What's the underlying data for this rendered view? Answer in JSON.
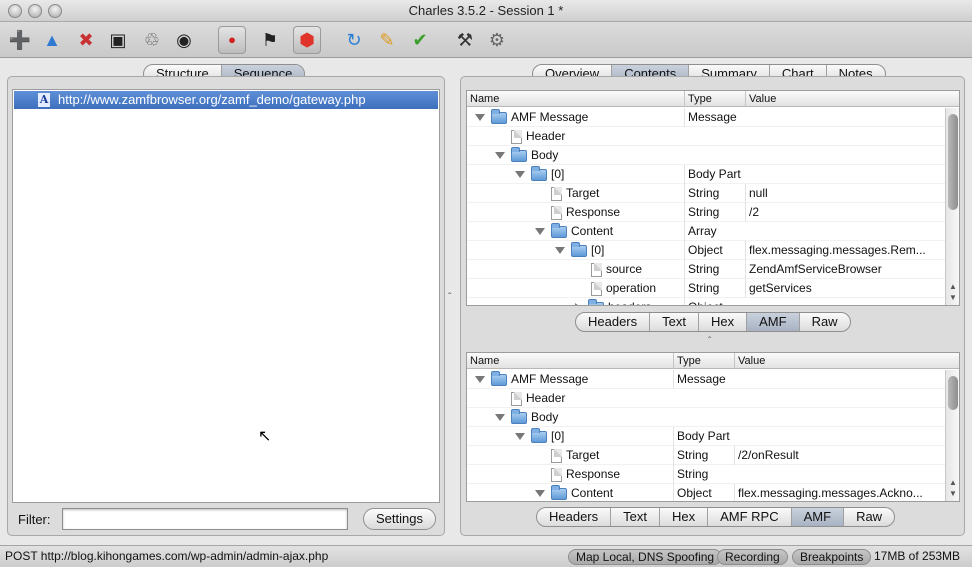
{
  "window": {
    "title": "Charles 3.5.2 - Session 1 *"
  },
  "toolbar": {
    "icons": [
      "new-session-icon",
      "open-session-icon",
      "close-session-icon",
      "save-session-icon",
      "clear-session-icon",
      "find-icon",
      "record-icon",
      "throttle-icon",
      "breakpoints-icon",
      "repeat-icon",
      "edit-icon",
      "validate-icon",
      "tools-icon",
      "settings-icon"
    ]
  },
  "left": {
    "tabs": [
      {
        "label": "Structure",
        "selected": false
      },
      {
        "label": "Sequence",
        "selected": true
      }
    ],
    "rows": [
      {
        "badge": "A",
        "url": "http://www.zamfbrowser.org/zamf_demo/gateway.php"
      }
    ],
    "filter_label": "Filter:",
    "filter_value": "",
    "settings_label": "Settings"
  },
  "right": {
    "tabs": [
      {
        "label": "Overview",
        "selected": false
      },
      {
        "label": "Contents",
        "selected": true
      },
      {
        "label": "Summary",
        "selected": false
      },
      {
        "label": "Chart",
        "selected": false
      },
      {
        "label": "Notes",
        "selected": false
      }
    ],
    "request": {
      "columns": {
        "name": "Name",
        "type": "Type",
        "value": "Value"
      },
      "rows": [
        {
          "depth": 0,
          "icon": "folder",
          "expand": "open",
          "name": "AMF Message",
          "type": "Message",
          "value": ""
        },
        {
          "depth": 1,
          "icon": "doc",
          "expand": "none",
          "name": "Header",
          "type": "",
          "value": ""
        },
        {
          "depth": 1,
          "icon": "folder",
          "expand": "open",
          "name": "Body",
          "type": "",
          "value": ""
        },
        {
          "depth": 2,
          "icon": "folder",
          "expand": "open",
          "name": "[0]",
          "type": "Body Part",
          "value": ""
        },
        {
          "depth": 3,
          "icon": "doc",
          "expand": "none",
          "name": "Target",
          "type": "String",
          "value": "null"
        },
        {
          "depth": 3,
          "icon": "doc",
          "expand": "none",
          "name": "Response",
          "type": "String",
          "value": "/2"
        },
        {
          "depth": 3,
          "icon": "folder",
          "expand": "open",
          "name": "Content",
          "type": "Array",
          "value": ""
        },
        {
          "depth": 4,
          "icon": "folder",
          "expand": "open",
          "name": "[0]",
          "type": "Object",
          "value": "flex.messaging.messages.Rem..."
        },
        {
          "depth": 5,
          "icon": "doc",
          "expand": "none",
          "name": "source",
          "type": "String",
          "value": "ZendAmfServiceBrowser"
        },
        {
          "depth": 5,
          "icon": "doc",
          "expand": "none",
          "name": "operation",
          "type": "String",
          "value": "getServices"
        },
        {
          "depth": 5,
          "icon": "folder",
          "expand": "closed",
          "name": "headers",
          "type": "Object",
          "value": ""
        }
      ],
      "tabs": [
        {
          "label": "Headers",
          "selected": false
        },
        {
          "label": "Text",
          "selected": false
        },
        {
          "label": "Hex",
          "selected": false
        },
        {
          "label": "AMF",
          "selected": true
        },
        {
          "label": "Raw",
          "selected": false
        }
      ]
    },
    "response": {
      "columns": {
        "name": "Name",
        "type": "Type",
        "value": "Value"
      },
      "rows": [
        {
          "depth": 0,
          "icon": "folder",
          "expand": "open",
          "name": "AMF Message",
          "type": "Message",
          "value": ""
        },
        {
          "depth": 1,
          "icon": "doc",
          "expand": "none",
          "name": "Header",
          "type": "",
          "value": ""
        },
        {
          "depth": 1,
          "icon": "folder",
          "expand": "open",
          "name": "Body",
          "type": "",
          "value": ""
        },
        {
          "depth": 2,
          "icon": "folder",
          "expand": "open",
          "name": "[0]",
          "type": "Body Part",
          "value": ""
        },
        {
          "depth": 3,
          "icon": "doc",
          "expand": "none",
          "name": "Target",
          "type": "String",
          "value": "/2/onResult"
        },
        {
          "depth": 3,
          "icon": "doc",
          "expand": "none",
          "name": "Response",
          "type": "String",
          "value": ""
        },
        {
          "depth": 3,
          "icon": "folder",
          "expand": "open",
          "name": "Content",
          "type": "Object",
          "value": "flex.messaging.messages.Ackno..."
        }
      ],
      "tabs": [
        {
          "label": "Headers",
          "selected": false
        },
        {
          "label": "Text",
          "selected": false
        },
        {
          "label": "Hex",
          "selected": false
        },
        {
          "label": "AMF RPC",
          "selected": false
        },
        {
          "label": "AMF",
          "selected": true
        },
        {
          "label": "Raw",
          "selected": false
        }
      ]
    }
  },
  "status": {
    "text": "POST http://blog.kihongames.com/wp-admin/admin-ajax.php",
    "pills": [
      "Map Local, DNS Spoofing",
      "Recording",
      "Breakpoints"
    ],
    "memory": "17MB of 253MB"
  }
}
